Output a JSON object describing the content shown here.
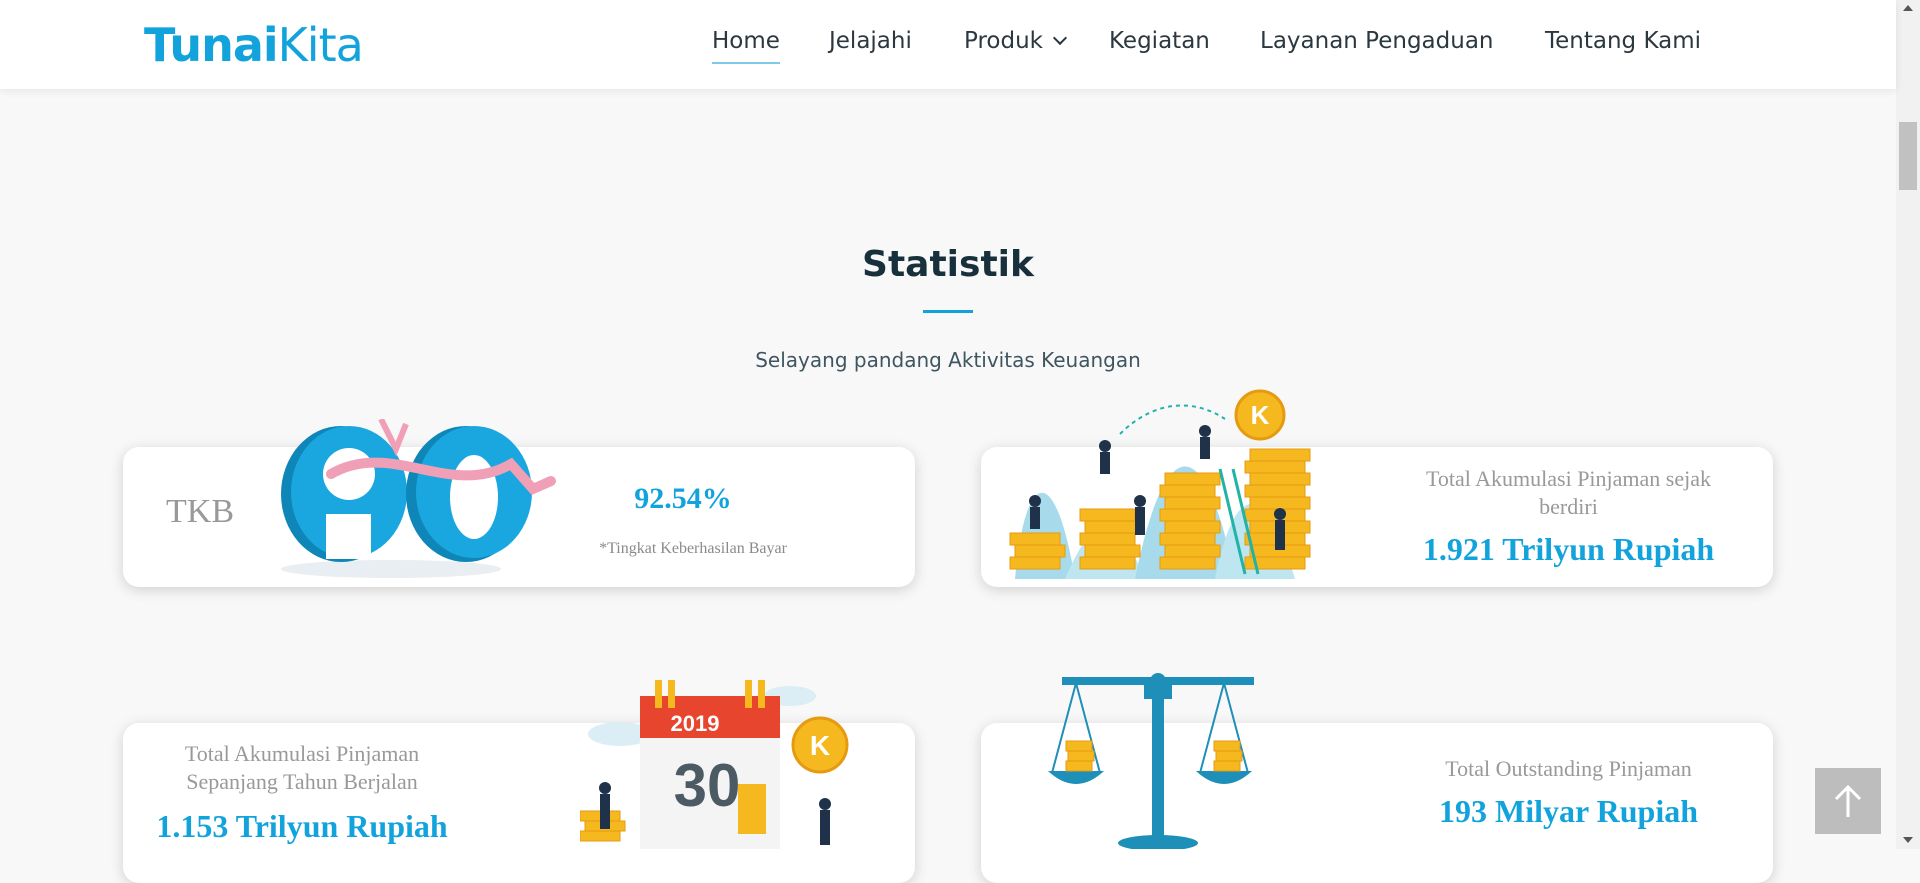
{
  "header": {
    "logo_tunai": "Tunai",
    "logo_kita": "Kita",
    "nav": {
      "home": "Home",
      "jelajahi": "Jelajahi",
      "produk": "Produk",
      "kegiatan": "Kegiatan",
      "layanan": "Layanan Pengaduan",
      "tentang": "Tentang Kami"
    }
  },
  "section": {
    "title": "Statistik",
    "subtitle": "Selayang pandang Aktivitas Keuangan"
  },
  "cards": {
    "tkb": {
      "label": "TKB",
      "badge": "90",
      "value": "92.54%",
      "note": "*Tingkat Keberhasilan Bayar"
    },
    "total_akumulasi": {
      "label": "Total Akumulasi Pinjaman sejak berdiri",
      "value": "1.921 Trilyun Rupiah",
      "coin_letter": "K"
    },
    "akumulasi_tahun": {
      "label": "Total Akumulasi Pinjaman Sepanjang Tahun Berjalan",
      "value": "1.153 Trilyun Rupiah",
      "calendar_year": "2019",
      "calendar_day": "30",
      "coin_letter": "K"
    },
    "outstanding": {
      "label": "Total Outstanding Pinjaman",
      "value": "193 Milyar Rupiah"
    }
  },
  "colors": {
    "brand_blue": "#12a3dd",
    "coin_gold": "#f6b81f",
    "teal": "#1d8fb8"
  },
  "icons": {
    "scroll_to_top": "arrow-up-icon"
  }
}
